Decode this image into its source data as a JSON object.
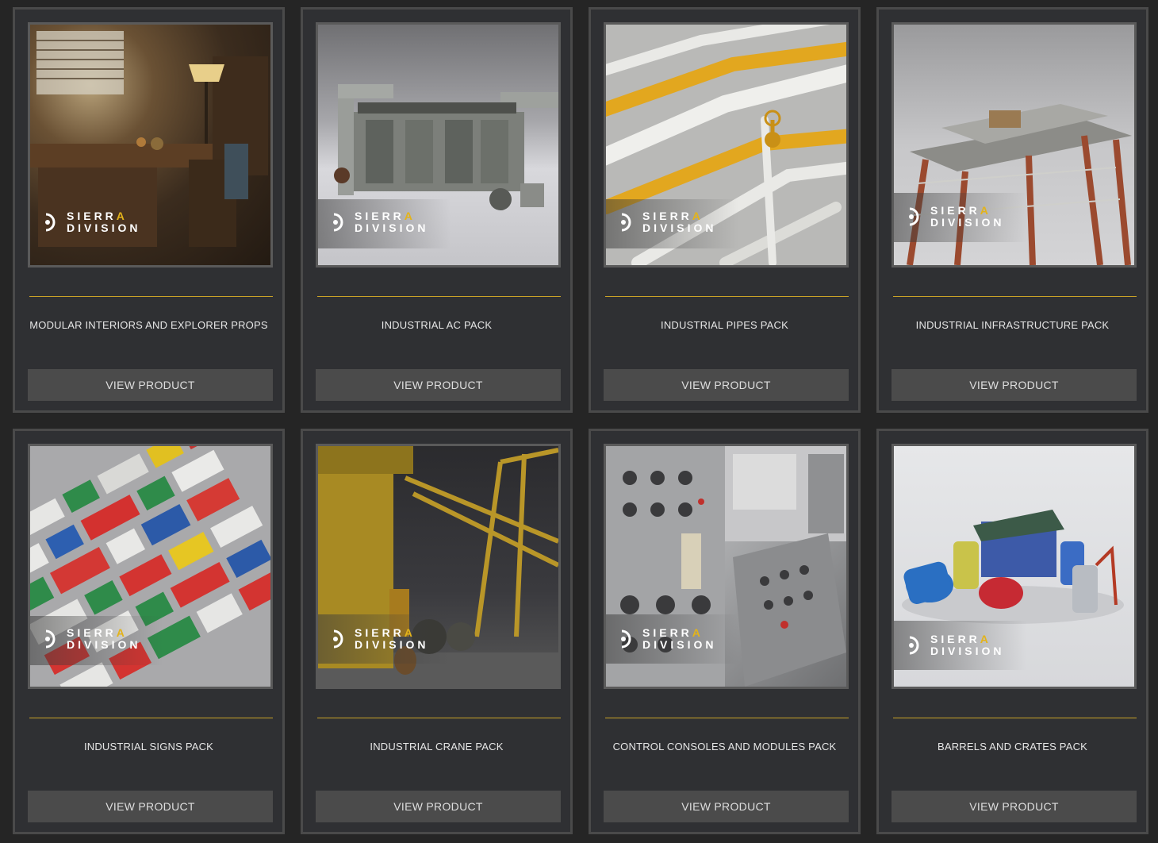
{
  "brand": {
    "sierra_prefix": "SIERR",
    "sierra_accent": "A",
    "division": "DIVISION",
    "accent_color": "#e3b31a"
  },
  "button_label": "VIEW PRODUCT",
  "products": [
    {
      "title": "MODULAR INTERIORS AND EXPLORER PROPS",
      "image": "interior-room-image"
    },
    {
      "title": "INDUSTRIAL AC PACK",
      "image": "ac-units-image"
    },
    {
      "title": "INDUSTRIAL PIPES PACK",
      "image": "pipes-image"
    },
    {
      "title": "INDUSTRIAL INFRASTRUCTURE PACK",
      "image": "offshore-platform-image"
    },
    {
      "title": "INDUSTRIAL SIGNS PACK",
      "image": "warning-signs-image"
    },
    {
      "title": "INDUSTRIAL CRANE PACK",
      "image": "crane-image"
    },
    {
      "title": "CONTROL CONSOLES AND MODULES PACK",
      "image": "control-console-image"
    },
    {
      "title": "BARRELS AND CRATES PACK",
      "image": "barrels-crates-image"
    }
  ]
}
